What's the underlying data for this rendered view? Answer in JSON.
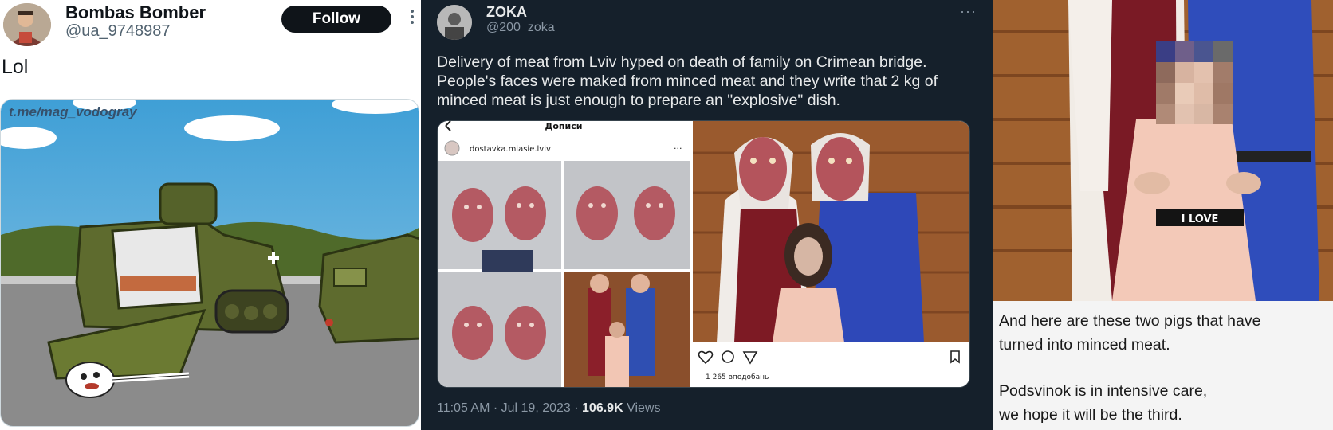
{
  "tweet1": {
    "author_name": "Bombas Bomber",
    "author_handle": "@ua_9748987",
    "follow_label": "Follow",
    "text": "Lol",
    "watermark": "t.me/mag_vodogray",
    "icons": [
      "avatar",
      "more-vertical-icon"
    ]
  },
  "tweet2": {
    "author_name": "ZOKA",
    "author_handle": "@200_zoka",
    "more_label": "···",
    "text_lines": [
      "Delivery of meat from Lviv hyped on death of family on Crimean bridge.",
      "People's faces were maked from minced meat and they write that 2 kg of",
      "minced meat is just enough to prepare an \"explosive\" dish."
    ],
    "embedded": {
      "header_title": "Дописи",
      "account": "dostavka.miasie.lviv",
      "likes_label": "1 265 вподобань",
      "icons": [
        "back-arrow-icon",
        "heart-icon",
        "comment-icon",
        "share-icon",
        "bookmark-icon",
        "more-icon"
      ]
    },
    "timestamp": "11:05 AM · Jul 19, 2023 · ",
    "views_count": "106.9K",
    "views_label": " Views"
  },
  "panel3": {
    "caption1_lines": [
      "And here are these two pigs that have",
      "turned into minced meat."
    ],
    "caption2_lines": [
      "Podsvinok is in intensive care,",
      "we hope it will be the third."
    ],
    "shirt_text": "I LOVE"
  },
  "colors": {
    "dark_bg": "#15202b",
    "follow_bg": "#0f1419",
    "sky": "#5aa9d8",
    "tank_green": "#5e6b2e"
  }
}
